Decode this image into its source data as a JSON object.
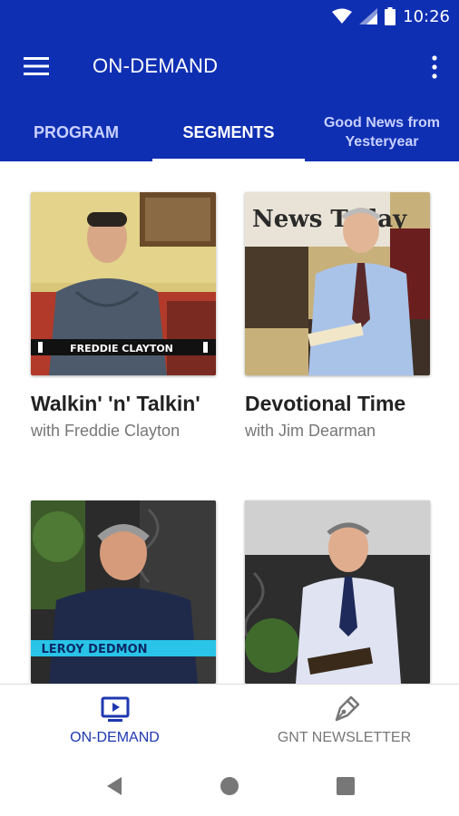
{
  "status": {
    "time": "10:26"
  },
  "app": {
    "title": "ON-DEMAND"
  },
  "tabs": [
    {
      "label": "PROGRAM",
      "active": false
    },
    {
      "label": "SEGMENTS",
      "active": true
    },
    {
      "label": "Good News from Yesteryear",
      "active": false
    }
  ],
  "cards": [
    {
      "title": "Walkin' 'n' Talkin'",
      "subtitle": "with Freddie Clayton",
      "thumb_caption": "FREDDIE CLAYTON"
    },
    {
      "title": "Devotional Time",
      "subtitle": "with Jim Dearman",
      "thumb_caption": "News Today"
    },
    {
      "title": "",
      "subtitle": "",
      "thumb_caption": "LEROY DEDMON"
    },
    {
      "title": "",
      "subtitle": "",
      "thumb_caption": ""
    }
  ],
  "bottom_nav": [
    {
      "label": "ON-DEMAND",
      "icon": "tv-icon",
      "active": true
    },
    {
      "label": "GNT NEWSLETTER",
      "icon": "pen-nib-icon",
      "active": false
    }
  ],
  "colors": {
    "primary": "#0f2fb3",
    "active_nav": "#1f38b0",
    "inactive_text": "#777777"
  }
}
